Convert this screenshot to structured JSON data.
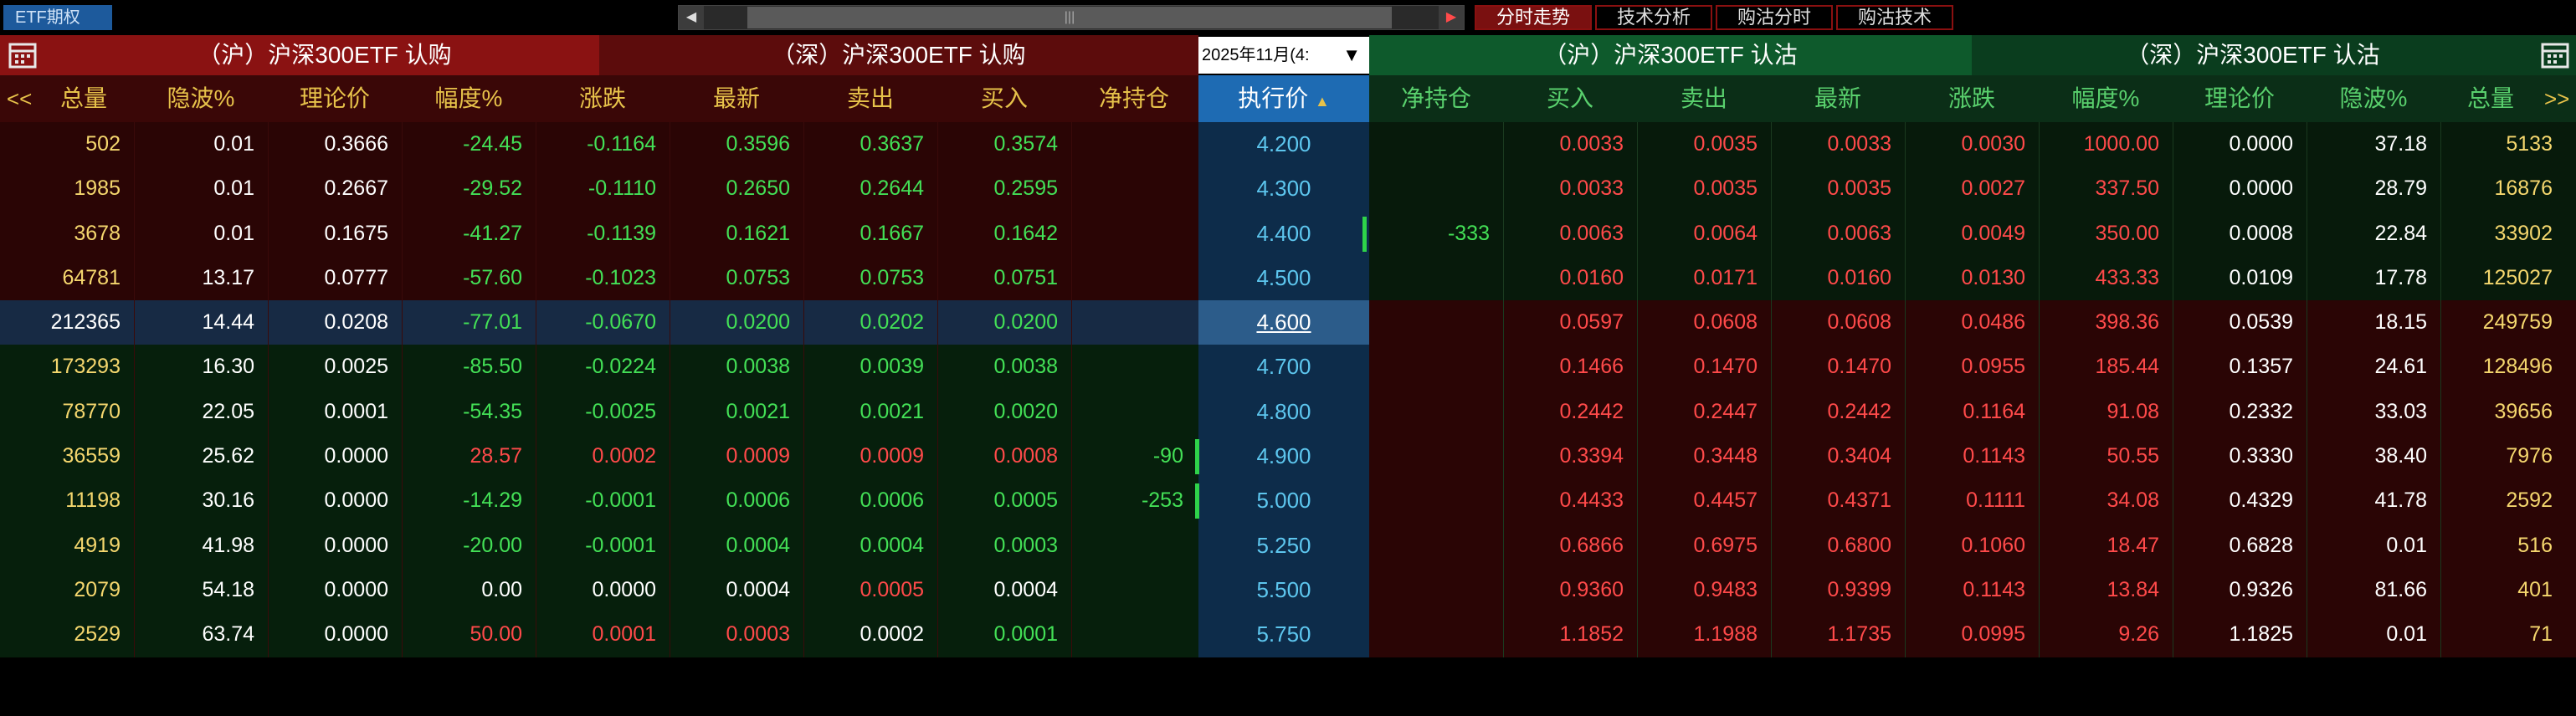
{
  "topbar": {
    "etf_tab": "ETF期权",
    "scroll_left": "◀",
    "scroll_right": "▶",
    "scroll_grip": "|||",
    "tabs": [
      "分时走势",
      "技术分析",
      "购沽分时",
      "购沽技术"
    ],
    "active_tab": 0
  },
  "headers": {
    "call_sh": "（沪）沪深300ETF 认购",
    "call_sz": "（深）沪深300ETF 认购",
    "month_select": "2025年11月(4:",
    "put_sh": "（沪）沪深300ETF 认沽",
    "put_sz": "（深）沪深300ETF 认沽",
    "left_cols": [
      "总量",
      "隐波%",
      "理论价",
      "幅度%",
      "涨跌",
      "最新",
      "卖出",
      "买入",
      "净持仓"
    ],
    "strike": "执行价",
    "right_cols": [
      "净持仓",
      "买入",
      "卖出",
      "最新",
      "涨跌",
      "幅度%",
      "理论价",
      "隐波%",
      "总量"
    ],
    "nav_left": "<<",
    "nav_right": ">>",
    "sort_arrow": "▲"
  },
  "colors": {
    "call_header": "#8a1212",
    "put_header": "#0e5a2c",
    "strike_header": "#1e6bb3",
    "up": "#ff4a4a",
    "down": "#43e056"
  },
  "rows": [
    {
      "strike": "4.200",
      "l": [
        "502",
        "0.01",
        "0.3666",
        "-24.45",
        "-0.1164",
        "0.3596",
        "0.3637",
        "0.3574",
        ""
      ],
      "lc": [
        "y",
        "w",
        "w",
        "g",
        "g",
        "g",
        "g",
        "g",
        "g"
      ],
      "r": [
        "",
        "0.0033",
        "0.0035",
        "0.0033",
        "0.0030",
        "1000.00",
        "0.0000",
        "37.18",
        "5133"
      ],
      "rc": [
        "g",
        "r",
        "r",
        "r",
        "r",
        "r",
        "w",
        "w",
        "y"
      ]
    },
    {
      "strike": "4.300",
      "l": [
        "1985",
        "0.01",
        "0.2667",
        "-29.52",
        "-0.1110",
        "0.2650",
        "0.2644",
        "0.2595",
        ""
      ],
      "lc": [
        "y",
        "w",
        "w",
        "g",
        "g",
        "g",
        "g",
        "g",
        "g"
      ],
      "r": [
        "",
        "0.0033",
        "0.0035",
        "0.0035",
        "0.0027",
        "337.50",
        "0.0000",
        "28.79",
        "16876"
      ],
      "rc": [
        "g",
        "r",
        "r",
        "r",
        "r",
        "r",
        "w",
        "w",
        "y"
      ]
    },
    {
      "strike": "4.400",
      "l": [
        "3678",
        "0.01",
        "0.1675",
        "-41.27",
        "-0.1139",
        "0.1621",
        "0.1667",
        "0.1642",
        ""
      ],
      "lc": [
        "y",
        "w",
        "w",
        "g",
        "g",
        "g",
        "g",
        "g",
        "g"
      ],
      "r": [
        "-333",
        "0.0063",
        "0.0064",
        "0.0063",
        "0.0049",
        "350.00",
        "0.0008",
        "22.84",
        "33902"
      ],
      "rc": [
        "g",
        "r",
        "r",
        "r",
        "r",
        "r",
        "w",
        "w",
        "y"
      ],
      "bar_r": true
    },
    {
      "strike": "4.500",
      "l": [
        "64781",
        "13.17",
        "0.0777",
        "-57.60",
        "-0.1023",
        "0.0753",
        "0.0753",
        "0.0751",
        ""
      ],
      "lc": [
        "y",
        "w",
        "w",
        "g",
        "g",
        "g",
        "g",
        "g",
        "g"
      ],
      "r": [
        "",
        "0.0160",
        "0.0171",
        "0.0160",
        "0.0130",
        "433.33",
        "0.0109",
        "17.78",
        "125027"
      ],
      "rc": [
        "g",
        "r",
        "r",
        "r",
        "r",
        "r",
        "w",
        "w",
        "y"
      ]
    },
    {
      "strike": "4.600",
      "l": [
        "212365",
        "14.44",
        "0.0208",
        "-77.01",
        "-0.0670",
        "0.0200",
        "0.0202",
        "0.0200",
        ""
      ],
      "lc": [
        "w",
        "w",
        "w",
        "g",
        "g",
        "g",
        "g",
        "g",
        "g"
      ],
      "r": [
        "",
        "0.0597",
        "0.0608",
        "0.0608",
        "0.0486",
        "398.36",
        "0.0539",
        "18.15",
        "249759"
      ],
      "rc": [
        "g",
        "r",
        "r",
        "r",
        "r",
        "r",
        "w",
        "w",
        "y"
      ],
      "selected": true
    },
    {
      "strike": "4.700",
      "l": [
        "173293",
        "16.30",
        "0.0025",
        "-85.50",
        "-0.0224",
        "0.0038",
        "0.0039",
        "0.0038",
        ""
      ],
      "lc": [
        "y",
        "w",
        "w",
        "g",
        "g",
        "g",
        "g",
        "g",
        "g"
      ],
      "r": [
        "",
        "0.1466",
        "0.1470",
        "0.1470",
        "0.0955",
        "185.44",
        "0.1357",
        "24.61",
        "128496"
      ],
      "rc": [
        "g",
        "r",
        "r",
        "r",
        "r",
        "r",
        "w",
        "w",
        "y"
      ]
    },
    {
      "strike": "4.800",
      "l": [
        "78770",
        "22.05",
        "0.0001",
        "-54.35",
        "-0.0025",
        "0.0021",
        "0.0021",
        "0.0020",
        ""
      ],
      "lc": [
        "y",
        "w",
        "w",
        "g",
        "g",
        "g",
        "g",
        "g",
        "g"
      ],
      "r": [
        "",
        "0.2442",
        "0.2447",
        "0.2442",
        "0.1164",
        "91.08",
        "0.2332",
        "33.03",
        "39656"
      ],
      "rc": [
        "g",
        "r",
        "r",
        "r",
        "r",
        "r",
        "w",
        "w",
        "y"
      ]
    },
    {
      "strike": "4.900",
      "l": [
        "36559",
        "25.62",
        "0.0000",
        "28.57",
        "0.0002",
        "0.0009",
        "0.0009",
        "0.0008",
        "-90"
      ],
      "lc": [
        "y",
        "w",
        "w",
        "r",
        "r",
        "r",
        "r",
        "r",
        "g"
      ],
      "r": [
        "",
        "0.3394",
        "0.3448",
        "0.3404",
        "0.1143",
        "50.55",
        "0.3330",
        "38.40",
        "7976"
      ],
      "rc": [
        "g",
        "r",
        "r",
        "r",
        "r",
        "r",
        "w",
        "w",
        "y"
      ],
      "bar_l": true
    },
    {
      "strike": "5.000",
      "l": [
        "11198",
        "30.16",
        "0.0000",
        "-14.29",
        "-0.0001",
        "0.0006",
        "0.0006",
        "0.0005",
        "-253"
      ],
      "lc": [
        "y",
        "w",
        "w",
        "g",
        "g",
        "g",
        "g",
        "g",
        "g"
      ],
      "r": [
        "",
        "0.4433",
        "0.4457",
        "0.4371",
        "0.1111",
        "34.08",
        "0.4329",
        "41.78",
        "2592"
      ],
      "rc": [
        "g",
        "r",
        "r",
        "r",
        "r",
        "r",
        "w",
        "w",
        "y"
      ],
      "bar_l": true
    },
    {
      "strike": "5.250",
      "l": [
        "4919",
        "41.98",
        "0.0000",
        "-20.00",
        "-0.0001",
        "0.0004",
        "0.0004",
        "0.0003",
        ""
      ],
      "lc": [
        "y",
        "w",
        "w",
        "g",
        "g",
        "g",
        "g",
        "g",
        "g"
      ],
      "r": [
        "",
        "0.6866",
        "0.6975",
        "0.6800",
        "0.1060",
        "18.47",
        "0.6828",
        "0.01",
        "516"
      ],
      "rc": [
        "g",
        "r",
        "r",
        "r",
        "r",
        "r",
        "w",
        "w",
        "y"
      ]
    },
    {
      "strike": "5.500",
      "l": [
        "2079",
        "54.18",
        "0.0000",
        "0.00",
        "0.0000",
        "0.0004",
        "0.0005",
        "0.0004",
        ""
      ],
      "lc": [
        "y",
        "w",
        "w",
        "w",
        "w",
        "w",
        "r",
        "w",
        "g"
      ],
      "r": [
        "",
        "0.9360",
        "0.9483",
        "0.9399",
        "0.1143",
        "13.84",
        "0.9326",
        "81.66",
        "401"
      ],
      "rc": [
        "g",
        "r",
        "r",
        "r",
        "r",
        "r",
        "w",
        "w",
        "y"
      ]
    },
    {
      "strike": "5.750",
      "l": [
        "2529",
        "63.74",
        "0.0000",
        "50.00",
        "0.0001",
        "0.0003",
        "0.0002",
        "0.0001",
        ""
      ],
      "lc": [
        "y",
        "w",
        "w",
        "r",
        "r",
        "r",
        "w",
        "g",
        "g"
      ],
      "r": [
        "",
        "1.1852",
        "1.1988",
        "1.1735",
        "0.0995",
        "9.26",
        "1.1825",
        "0.01",
        "71"
      ],
      "rc": [
        "g",
        "r",
        "r",
        "r",
        "r",
        "r",
        "w",
        "w",
        "y"
      ]
    }
  ]
}
